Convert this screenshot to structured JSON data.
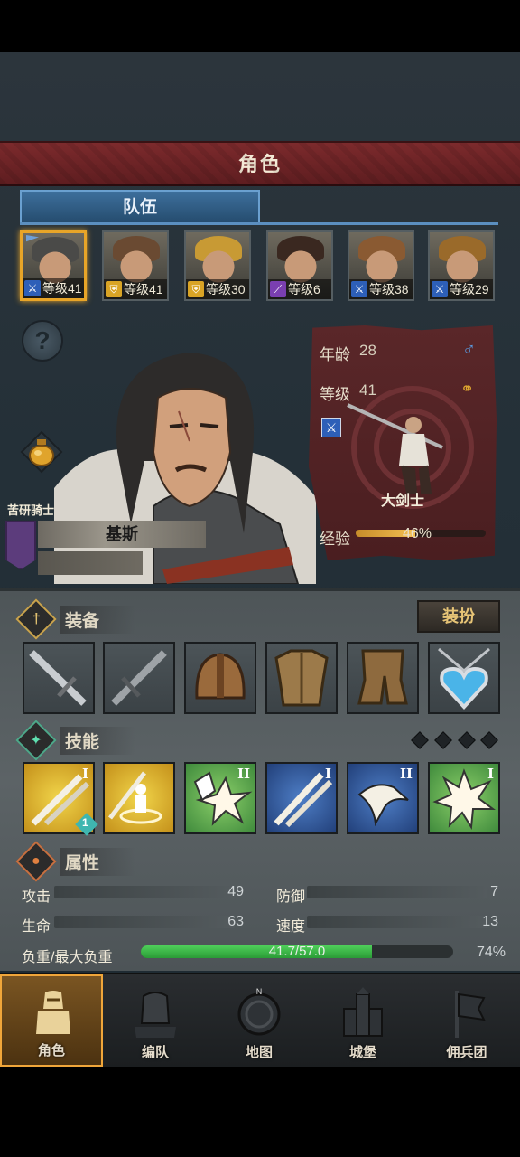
{
  "header": {
    "title": "角色"
  },
  "tabs": {
    "team": "队伍"
  },
  "roster": [
    {
      "class": "sword",
      "class_color": "#2d5fb8",
      "level": "等级41",
      "selected": true
    },
    {
      "class": "shield",
      "class_color": "#d9a425",
      "level": "等级41",
      "selected": false
    },
    {
      "class": "shield",
      "class_color": "#d9a425",
      "level": "等级30",
      "selected": false
    },
    {
      "class": "staff",
      "class_color": "#7a3fb0",
      "level": "等级6",
      "selected": false
    },
    {
      "class": "sword",
      "class_color": "#2d5fb8",
      "level": "等级38",
      "selected": false
    },
    {
      "class": "sword",
      "class_color": "#2d5fb8",
      "level": "等级29",
      "selected": false
    }
  ],
  "character": {
    "title": "苦研骑士",
    "name": "基斯",
    "age_label": "年龄",
    "age": "28",
    "level_label": "等级",
    "level": "41",
    "class_name": "大剑士",
    "exp_label": "经验",
    "exp_percent": "46%",
    "exp_fraction": 0.46
  },
  "sections": {
    "equipment": "装备",
    "costume_button": "装扮",
    "skills": "技能",
    "attributes": "属性"
  },
  "equipment": [
    "sword-icon",
    "sword-icon",
    "helmet-icon",
    "armor-icon",
    "boots-icon",
    "amulet-icon"
  ],
  "skills": [
    {
      "icon": "cross-swords-icon",
      "rank": "I",
      "bg": "gold",
      "badge": "1"
    },
    {
      "icon": "summon-icon",
      "rank": "",
      "bg": "gold"
    },
    {
      "icon": "burst-icon",
      "rank": "II",
      "bg": "green"
    },
    {
      "icon": "cross-swords-icon",
      "rank": "I",
      "bg": "blue"
    },
    {
      "icon": "beast-icon",
      "rank": "II",
      "bg": "blue"
    },
    {
      "icon": "explosion-icon",
      "rank": "I",
      "bg": "green"
    }
  ],
  "attributes": {
    "attack_label": "攻击",
    "attack": "49",
    "defense_label": "防御",
    "defense": "7",
    "hp_label": "生命",
    "hp": "63",
    "speed_label": "速度",
    "speed": "13",
    "load_label": "负重/最大负重",
    "load": "41.7/57.0",
    "load_percent": "74%",
    "load_fraction": 0.74
  },
  "nav": [
    {
      "label": "角色",
      "active": true
    },
    {
      "label": "编队",
      "active": false
    },
    {
      "label": "地图",
      "active": false
    },
    {
      "label": "城堡",
      "active": false
    },
    {
      "label": "佣兵团",
      "active": false
    }
  ],
  "nav_compass_letter": "N"
}
